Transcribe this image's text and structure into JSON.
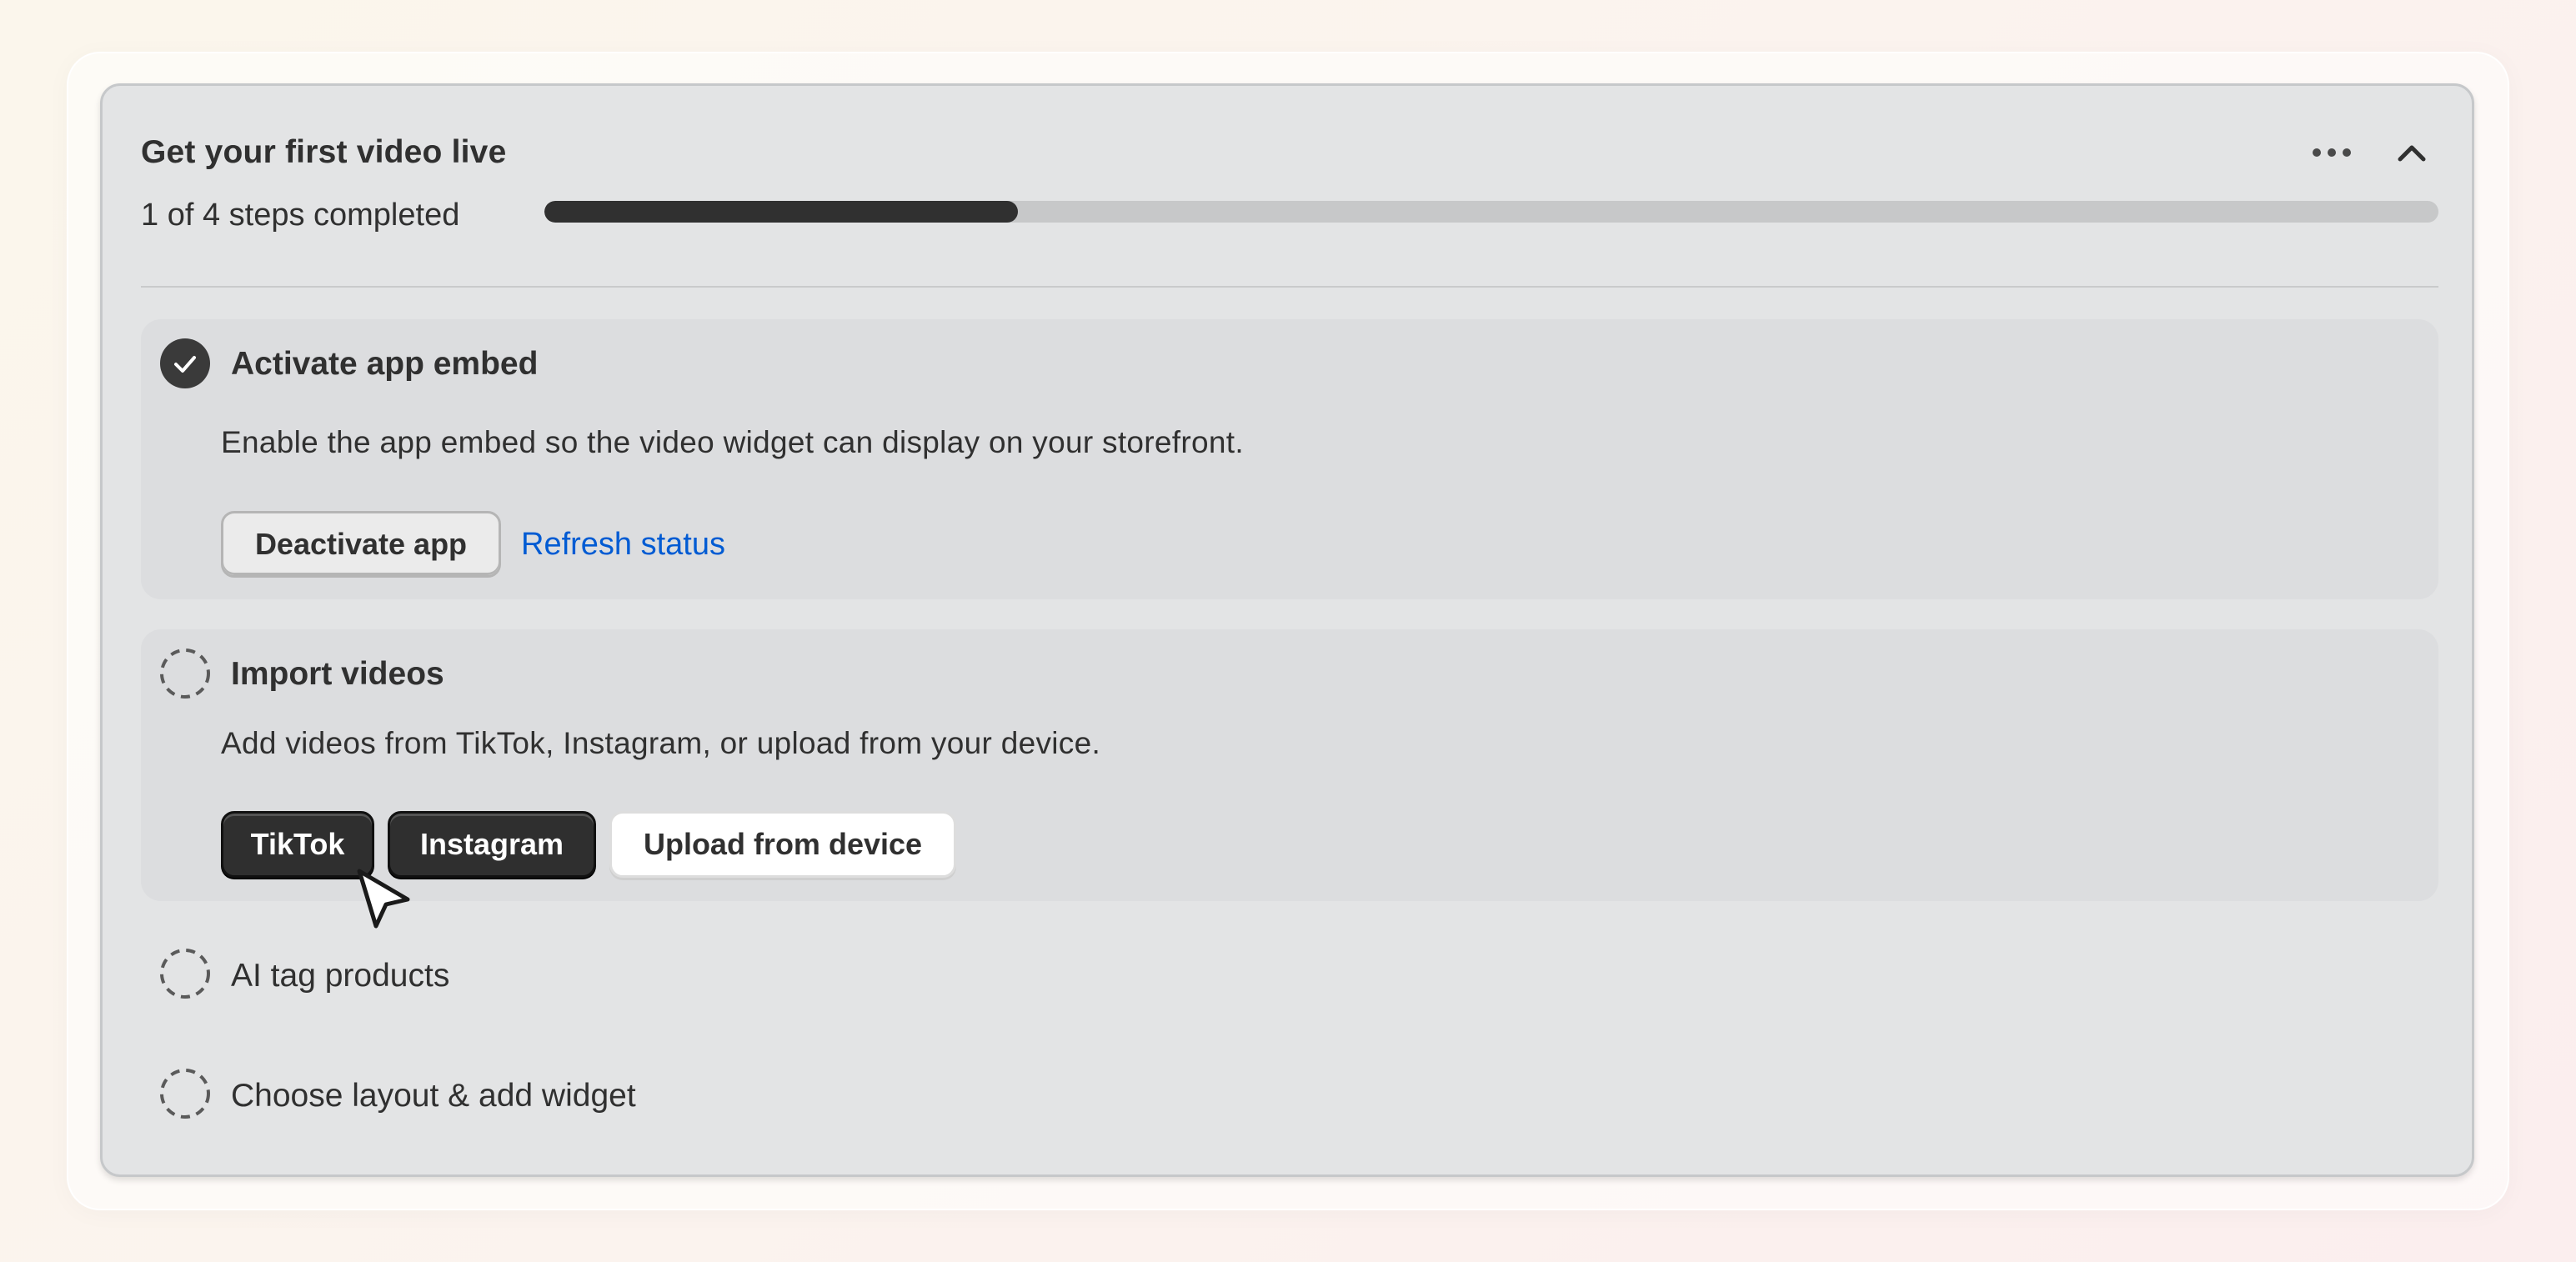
{
  "card": {
    "title": "Get your first video live",
    "progress_label": "1 of 4 steps completed",
    "progress_fraction": 0.25
  },
  "header": {
    "more_icon": "more-horizontal-icon",
    "collapse_icon": "chevron-up-icon"
  },
  "steps": [
    {
      "title": "Activate app embed",
      "status": "completed",
      "description": "Enable the app embed so the video widget can display on your storefront.",
      "primary_button": "Deactivate app",
      "link": "Refresh status"
    },
    {
      "title": "Import videos",
      "status": "incomplete",
      "description": "Add videos from TikTok, Instagram, or upload from your device.",
      "buttons": [
        "TikTok",
        "Instagram",
        "Upload from device"
      ]
    },
    {
      "title": "AI tag products",
      "status": "incomplete"
    },
    {
      "title": "Choose layout & add widget",
      "status": "incomplete"
    }
  ],
  "colors": {
    "card_bg": "#e3e4e5",
    "active_step_bg": "#dcdddf",
    "text": "#303030",
    "link": "#005bd3",
    "progress_fill": "#303030",
    "progress_track": "#c7c8c9"
  }
}
